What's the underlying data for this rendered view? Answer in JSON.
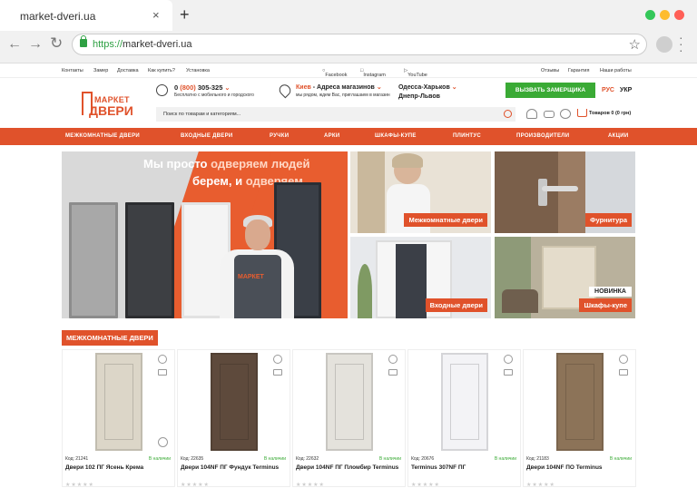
{
  "browser": {
    "tab_title": "market-dveri.ua",
    "tab_close": "×",
    "new_tab": "+",
    "url_scheme": "https://",
    "url_host": "market-dveri.ua",
    "traffic_colors": [
      "#34c759",
      "#febc2e",
      "#ff5f57"
    ]
  },
  "topbar": {
    "links": [
      "Контакты",
      "Замер",
      "Доставка",
      "Как купить?",
      "Установка"
    ],
    "social": [
      "Facebook",
      "Instagram",
      "YouTube"
    ],
    "right_links": [
      "Отзывы",
      "Гарантия",
      "Наши работы"
    ]
  },
  "header": {
    "logo_top": "МАРКЕТ",
    "logo_bottom": "ДВЕРИ",
    "phone_prefix": "0",
    "phone_code": "(800)",
    "phone_number": "305-325",
    "phone_note": "Бесплатно с мобильного и городского",
    "city_main": "Киев",
    "city_link": "- Адреса магазинов",
    "city_note": "мы рядом, ждем Вас, приглашаем в магазин",
    "cities_line1": "Одесса-Харьков",
    "cities_line2": "Днепр-Львов",
    "measure_button": "ВЫЗВАТЬ ЗАМЕРЩИКА",
    "lang_ru": "РУС",
    "lang_uk": "УКР",
    "search_placeholder": "Поиск по товарам и категориям...",
    "cart_text": "Товаров 0 (0 грн)",
    "accent": "#e0522b",
    "green": "#3aaa35"
  },
  "nav": [
    "МЕЖКОМНАТНЫЕ ДВЕРИ",
    "ВХОДНЫЕ ДВЕРИ",
    "РУЧКИ",
    "АРКИ",
    "ШКАФЫ-КУПЕ",
    "ПЛИНТУС",
    "ПРОИЗВОДИТЕЛИ",
    "АКЦИИ"
  ],
  "hero": {
    "line1_a": "Мы просто",
    "line1_b": "одверяем людей",
    "line2_a": "берем, и",
    "line2_b": "одверяем",
    "apron": "МАРКЕТ"
  },
  "tiles": {
    "interior": "Межкомнатные двери",
    "hardware": "Фурнитура",
    "entrance": "Входные двери",
    "wardrobe": "Шкафы-купе",
    "new_badge": "НОВИНКА"
  },
  "section_title": "МЕЖКОМНАТНЫЕ ДВЕРИ",
  "products": [
    {
      "code": "Код: 21241",
      "stock": "В наличии",
      "name": "Двери 102 ПГ Ясень Крема",
      "color": "#dcd6c8"
    },
    {
      "code": "Код: 22635",
      "stock": "В наличии",
      "name": "Двери 104NF ПГ Фундук Terminus",
      "color": "#5e4a3c"
    },
    {
      "code": "Код: 22632",
      "stock": "В наличии",
      "name": "Двери 104NF ПГ Пломбир Terminus",
      "color": "#e4e2dc"
    },
    {
      "code": "Код: 20676",
      "stock": "В наличии",
      "name": "Terminus 307NF ПГ",
      "color": "#f3f3f6"
    },
    {
      "code": "Код: 21183",
      "stock": "В наличии",
      "name": "Двери 104NF ПО Terminus",
      "color": "#8c7358"
    }
  ],
  "stars": "★★★★★"
}
